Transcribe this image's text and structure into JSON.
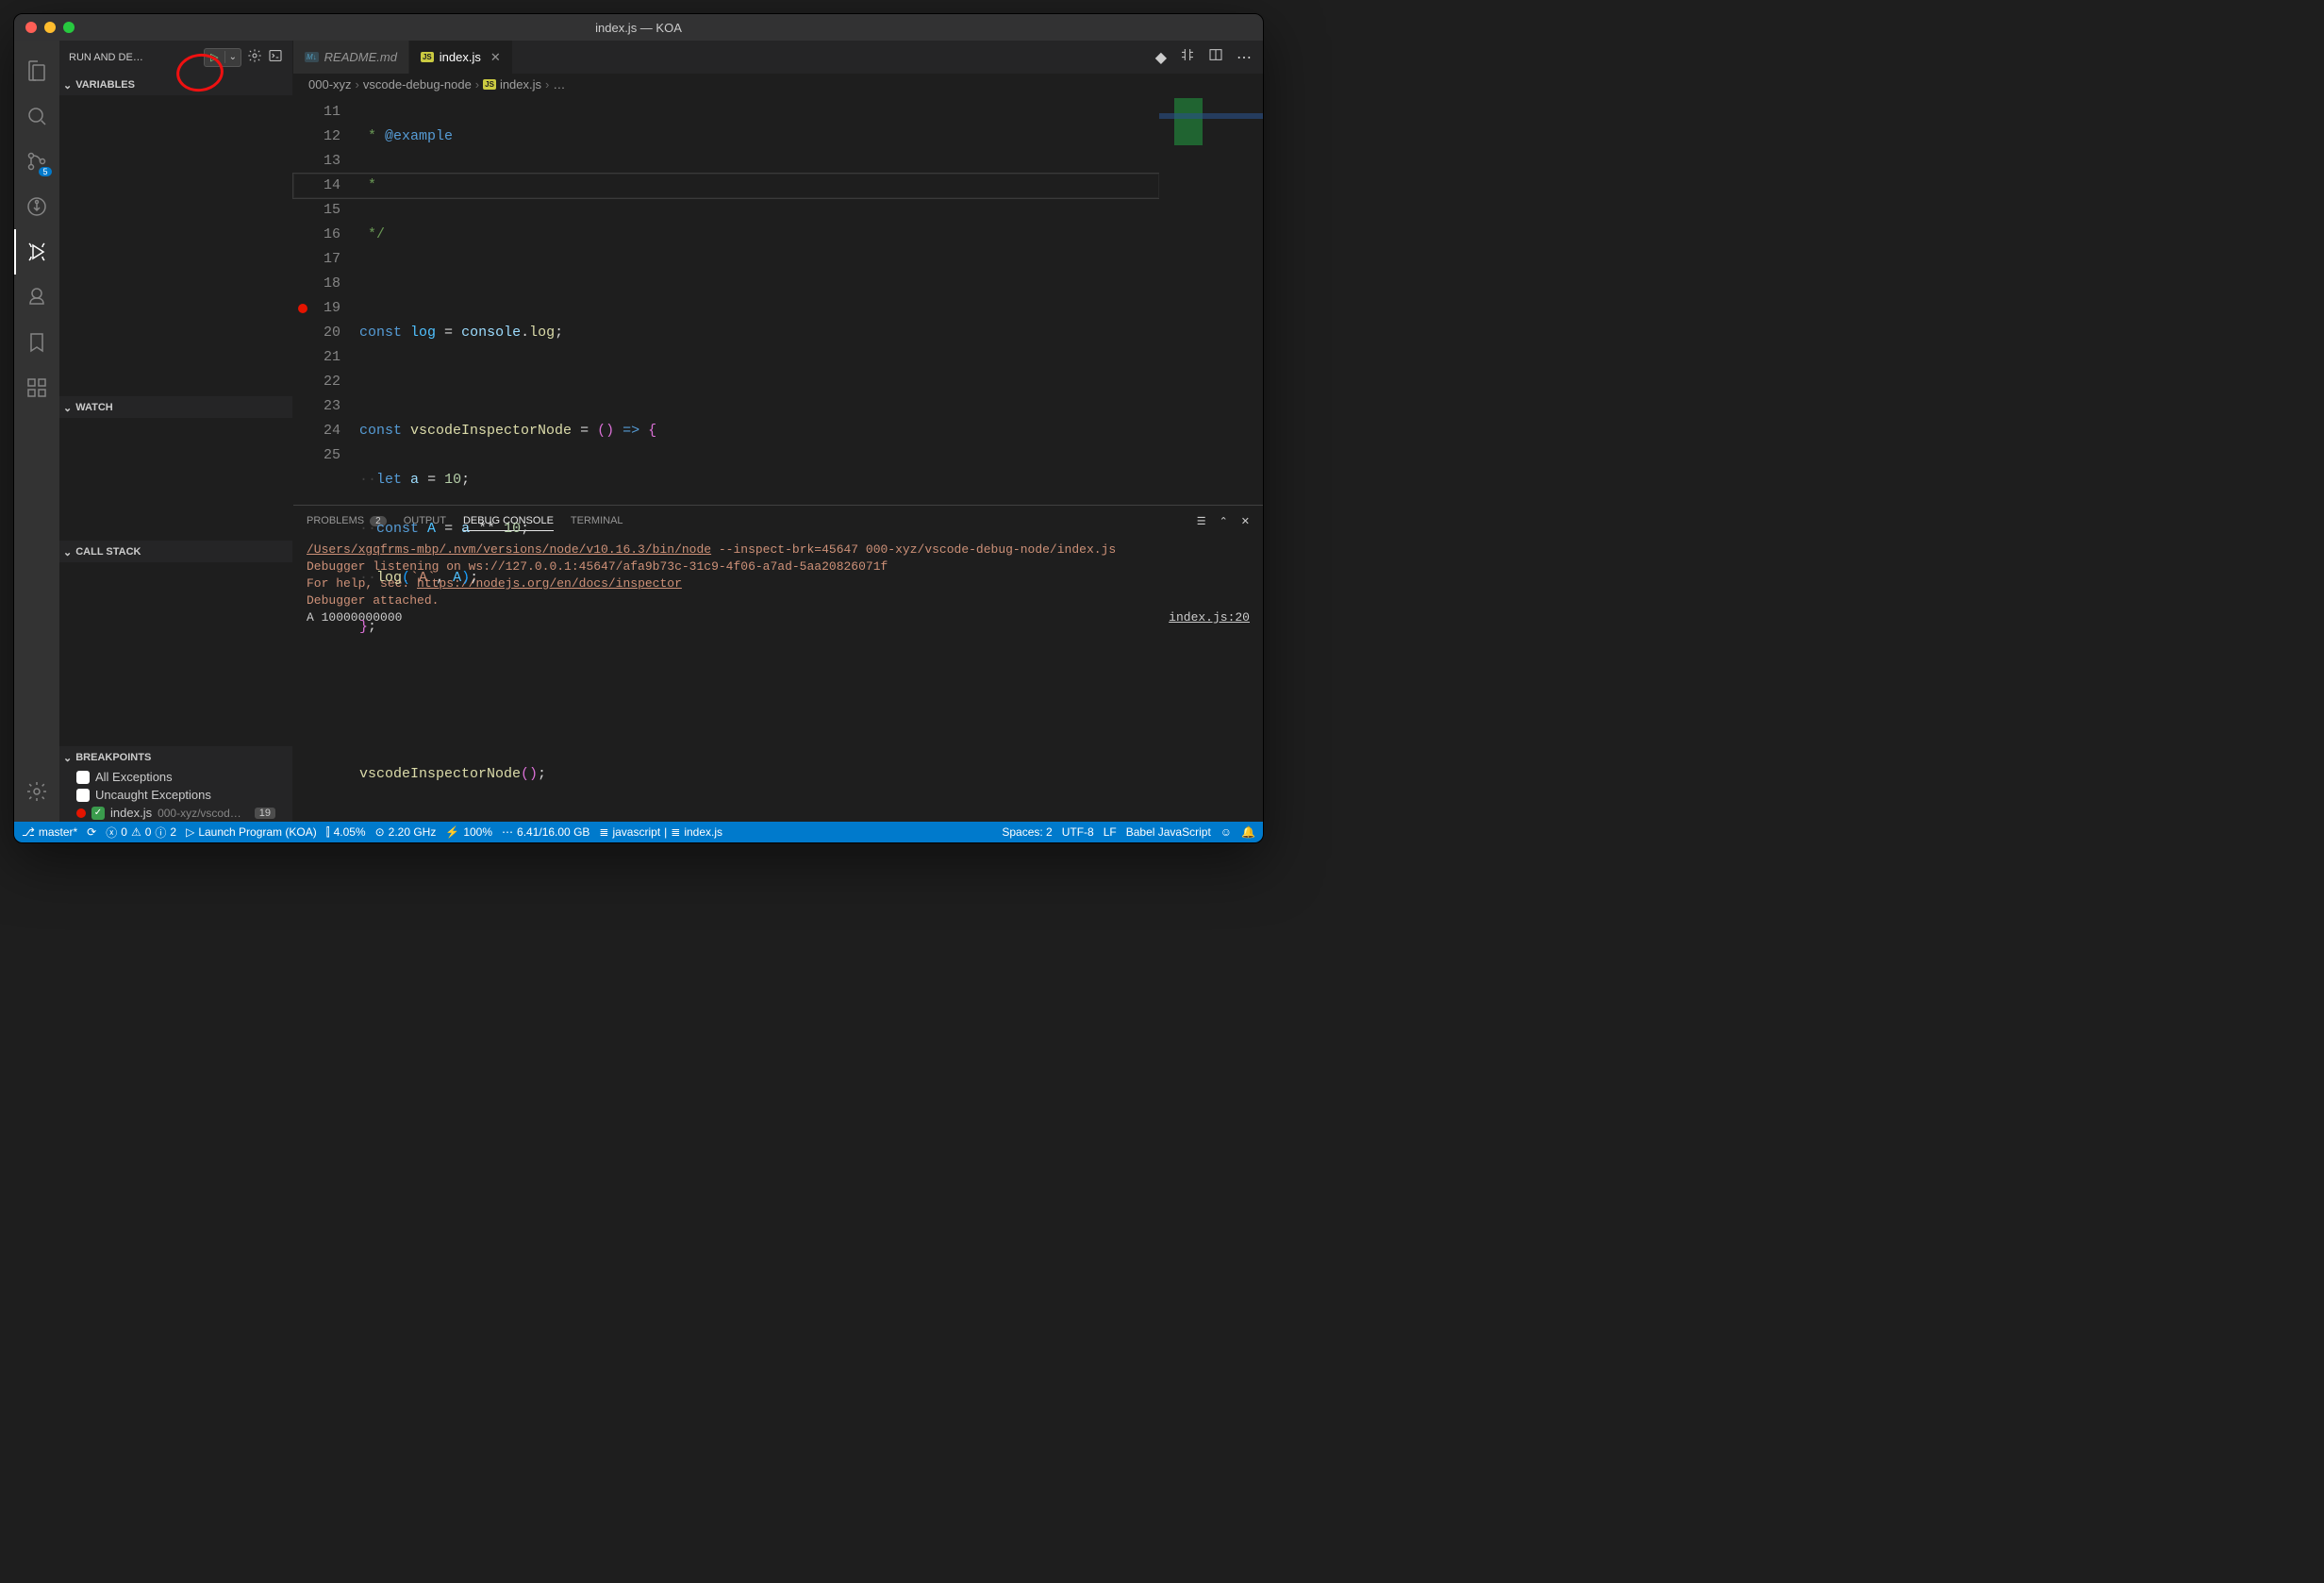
{
  "window": {
    "title": "index.js — KOA"
  },
  "sidebar": {
    "title": "RUN AND DE…",
    "sections": {
      "variables": "VARIABLES",
      "watch": "WATCH",
      "callstack": "CALL STACK",
      "breakpoints": "BREAKPOINTS"
    },
    "breakpoints": {
      "all_exceptions": "All Exceptions",
      "uncaught_exceptions": "Uncaught Exceptions",
      "file": "index.js",
      "file_path": "000-xyz/vscod…",
      "file_line": "19"
    }
  },
  "activity": {
    "scm_badge": "5"
  },
  "tabs": [
    {
      "icon": "M↓",
      "label": "README.md"
    },
    {
      "icon": "JS",
      "label": "index.js"
    }
  ],
  "breadcrumb": {
    "seg1": "000-xyz",
    "seg2": "vscode-debug-node",
    "seg3": "index.js",
    "seg4": "…"
  },
  "editor": {
    "lines": [
      11,
      12,
      13,
      14,
      15,
      16,
      17,
      18,
      19,
      20,
      21,
      22,
      23,
      24,
      25
    ],
    "breakpoint_line": 19,
    "code": {
      "l11_pre": " * ",
      "l11_tag": "@example",
      "l12": " *",
      "l13": " */",
      "l15_const": "const",
      "l15_log": "log",
      "l15_eq": " = ",
      "l15_console": "console",
      "l15_dot": ".",
      "l15_log2": "log",
      "l15_semi": ";",
      "l17_const": "const",
      "l17_name": "vscodeInspectorNode",
      "l17_eq": " = ",
      "l17_par": "()",
      "l17_arrow": " => ",
      "l17_brace": "{",
      "l18_let": "let",
      "l18_a": "a",
      "l18_eq": " = ",
      "l18_10": "10",
      "l18_semi": ";",
      "l19_const": "const",
      "l19_A": "A",
      "l19_eq": " = ",
      "l19_a": "a",
      "l19_pow": " ** ",
      "l19_10": "10",
      "l19_semi": ";",
      "l20_log": "log",
      "l20_open": "(",
      "l20_str": "`A`",
      "l20_comma": ", ",
      "l20_A": "A",
      "l20_close": ")",
      "l20_semi": ";",
      "l21_brace": "}",
      "l21_semi": ";",
      "l24_call": "vscodeInspectorNode",
      "l24_par": "()",
      "l24_semi": ";"
    }
  },
  "panel": {
    "tabs": {
      "problems": "PROBLEMS",
      "problems_badge": "2",
      "output": "OUTPUT",
      "debug": "DEBUG CONSOLE",
      "terminal": "TERMINAL"
    },
    "console": {
      "node_path": "/Users/xgqfrms-mbp/.nvm/versions/node/v10.16.3/bin/node",
      "node_args": " --inspect-brk=45647 000-xyz/vscode-debug-node/index.js",
      "listening": "Debugger listening on ws://127.0.0.1:45647/afa9b73c-31c9-4f06-a7ad-5aa20826071f",
      "help_pre": "For help, see: ",
      "help_url": "https://nodejs.org/en/docs/inspector",
      "attached": "Debugger attached.",
      "output": "A 10000000000",
      "src": "index.js:20"
    }
  },
  "status": {
    "branch": "master*",
    "errors": "0",
    "warnings": "0",
    "info": "2",
    "launch": "Launch Program (KOA)",
    "cpu": "4.05%",
    "freq": "2.20 GHz",
    "battery": "100%",
    "memory": "6.41/16.00 GB",
    "lang": "javascript",
    "file": "index.js",
    "spaces": "Spaces: 2",
    "encoding": "UTF-8",
    "eol": "LF",
    "mode": "Babel JavaScript"
  }
}
